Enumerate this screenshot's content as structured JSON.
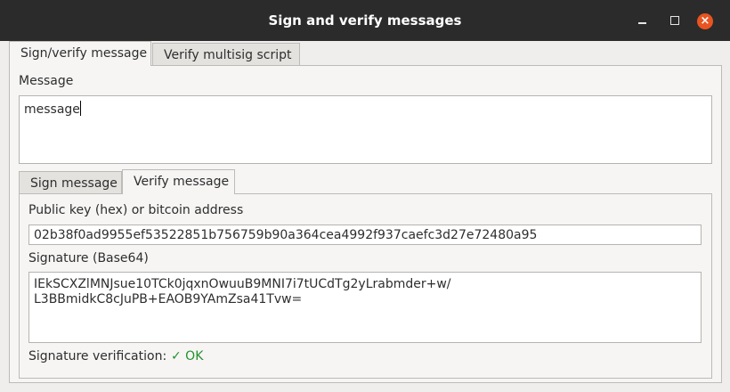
{
  "window": {
    "title": "Sign and verify messages",
    "close_glyph": "×"
  },
  "tabs": [
    "Sign/verify message",
    "Verify multisig script"
  ],
  "message": {
    "label": "Message",
    "value": "message"
  },
  "inner_tabs": [
    "Sign message",
    "Verify message"
  ],
  "verify": {
    "pubkey_label": "Public key (hex) or bitcoin address",
    "pubkey_value": "02b38f0ad9955ef53522851b756759b90a364cea4992f937caefc3d27e72480a95",
    "signature_label": "Signature (Base64)",
    "signature_lines": [
      "IEkSCXZlMNJsue10TCk0jqxnOwuuB9MNI7i7tUCdTg2yLrabmder+w/",
      "L3BBmidkC8cJuPB+EAOB9YAmZsa41Tvw="
    ],
    "status_label": "Signature verification:",
    "status_value": "✓ OK"
  },
  "colors": {
    "titlebar": "#2b2b2b",
    "close_button": "#e95420",
    "ok": "#24902d"
  }
}
